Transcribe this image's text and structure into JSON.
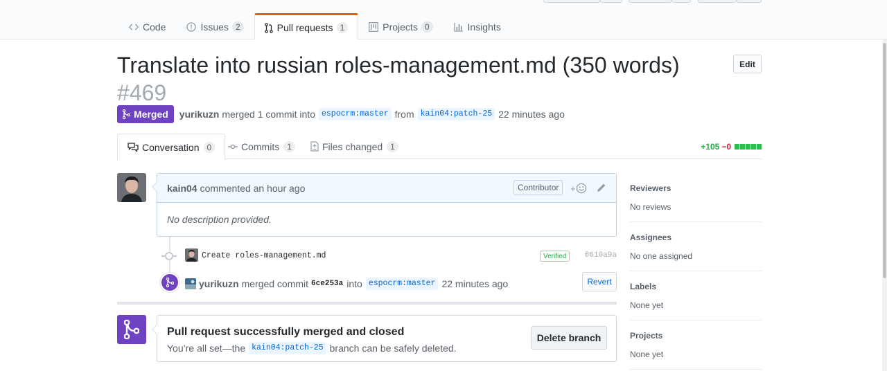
{
  "nav": {
    "tabs": [
      {
        "label": "Code",
        "count": ""
      },
      {
        "label": "Issues",
        "count": "2"
      },
      {
        "label": "Pull requests",
        "count": "1"
      },
      {
        "label": "Projects",
        "count": "0"
      },
      {
        "label": "Insights",
        "count": ""
      }
    ],
    "selected": "Pull requests"
  },
  "pr": {
    "title": "Translate into russian roles-management.md (350 words)",
    "number": "#469",
    "edit_label": "Edit",
    "state": "Merged",
    "merged_by": "yurikuzn",
    "meta_text_1": "merged 1 commit into",
    "base_ref": "espocrm:master",
    "meta_text_2": "from",
    "head_ref": "kain04:patch-25",
    "merged_ago": "22 minutes ago"
  },
  "subtabs": [
    {
      "label": "Conversation",
      "count": "0"
    },
    {
      "label": "Commits",
      "count": "1"
    },
    {
      "label": "Files changed",
      "count": "1"
    }
  ],
  "diffstat": {
    "additions": "+105",
    "deletions": "−0"
  },
  "comment": {
    "author": "kain04",
    "action": "commented an hour ago",
    "badge": "Contributor",
    "reaction_label": "+",
    "body": "No description provided."
  },
  "commit": {
    "message": "Create roles-management.md",
    "verified": "Verified",
    "sha": "6610a9a"
  },
  "merge_event": {
    "author": "yurikuzn",
    "text_1": "merged commit",
    "sha": "6ce253a",
    "text_2": "into",
    "ref": "espocrm:master",
    "time": "22 minutes ago",
    "revert_label": "Revert"
  },
  "merged_box": {
    "title": "Pull request successfully merged and closed",
    "desc_1": "You’re all set—the",
    "branch": "kain04:patch-25",
    "desc_2": "branch can be safely deleted.",
    "delete_label": "Delete branch"
  },
  "sidebar": [
    {
      "heading": "Reviewers",
      "value": "No reviews"
    },
    {
      "heading": "Assignees",
      "value": "No one assigned"
    },
    {
      "heading": "Labels",
      "value": "None yet"
    },
    {
      "heading": "Projects",
      "value": "None yet"
    }
  ],
  "colors": {
    "merged": "#6f42c1",
    "accent_tab": "#e36209",
    "link": "#0366d6",
    "diff_add": "#28a745",
    "diff_del": "#cb2431"
  }
}
